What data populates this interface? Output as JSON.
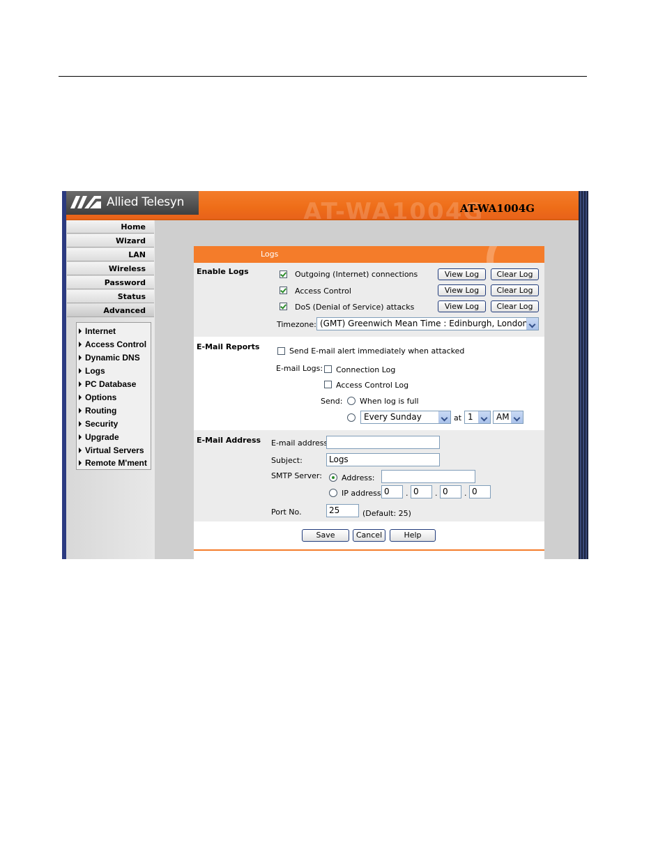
{
  "banner": {
    "logo_text": "Allied Telesyn",
    "watermark": "AT-WA1004G",
    "model": "AT-WA1004G"
  },
  "nav": {
    "main": [
      "Home",
      "Wizard",
      "LAN",
      "Wireless",
      "Password",
      "Status",
      "Advanced"
    ],
    "active": "Advanced",
    "sub": [
      "Internet",
      "Access Control",
      "Dynamic DNS",
      "Logs",
      "PC Database",
      "Options",
      "Routing",
      "Security",
      "Upgrade",
      "Virtual Servers",
      "Remote M'ment"
    ]
  },
  "panel": {
    "title": "Logs",
    "enable_logs": {
      "heading": "Enable Logs",
      "items": [
        {
          "label": "Outgoing (Internet) connections",
          "checked": true
        },
        {
          "label": "Access Control",
          "checked": true
        },
        {
          "label": "DoS (Denial of Service) attacks",
          "checked": true
        }
      ],
      "view_label": "View Log",
      "clear_label": "Clear Log",
      "timezone_label": "Timezone:",
      "timezone_value": "(GMT) Greenwich Mean Time : Edinburgh, London"
    },
    "email_reports": {
      "heading": "E-Mail Reports",
      "alert_label": "Send E-mail alert immediately when attacked",
      "alert_checked": false,
      "email_logs_label": "E-mail Logs:",
      "connection_log": "Connection Log",
      "access_control_log": "Access Control Log",
      "send_label": "Send:",
      "when_full": "When log is full",
      "schedule_day": "Every Sunday",
      "at_label": "at",
      "hour": "1",
      "ampm": "AM"
    },
    "email_address": {
      "heading": "E-Mail Address",
      "email_label": "E-mail address:",
      "email_value": "",
      "subject_label": "Subject:",
      "subject_value": "Logs",
      "smtp_label": "SMTP Server:",
      "address_label": "Address:",
      "address_value": "",
      "ip_label": "IP address:",
      "ip": [
        "0",
        "0",
        "0",
        "0"
      ],
      "port_label": "Port No.",
      "port_value": "25",
      "port_default": "(Default: 25)"
    },
    "buttons": {
      "save": "Save",
      "cancel": "Cancel",
      "help": "Help"
    }
  },
  "colors": {
    "accent": "#f47c2a",
    "button_border": "#1f3a7a",
    "sidebar": "#d8d8d8"
  }
}
